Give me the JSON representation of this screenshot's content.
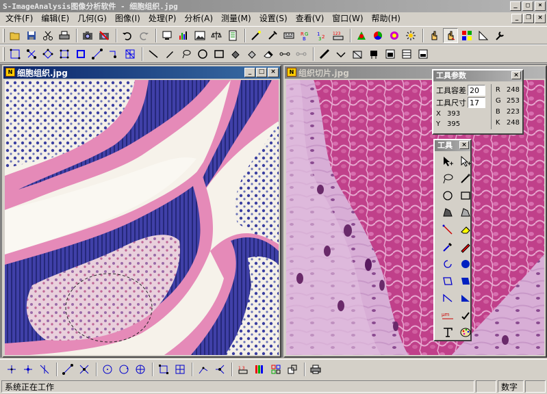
{
  "app": {
    "title": "S-ImageAnalysis图像分析软件 - 细胞组织.jpg"
  },
  "menu": [
    "文件(F)",
    "编辑(E)",
    "几何(G)",
    "图像(I)",
    "处理(P)",
    "分析(A)",
    "测量(M)",
    "设置(S)",
    "查看(V)",
    "窗口(W)",
    "帮助(H)"
  ],
  "windows": {
    "left": {
      "title": "细胞组织.jpg",
      "icon_text": "N"
    },
    "right": {
      "title": "组织切片.jpg",
      "icon_text": "N"
    }
  },
  "tool_params": {
    "title": "工具参数",
    "tolerance_label": "工具容差",
    "tolerance_value": "20",
    "size_label": "工具尺寸",
    "size_value": "17",
    "x_label": "X",
    "x_value": "393",
    "y_label": "Y",
    "y_value": "395",
    "r_label": "R",
    "r_value": "248",
    "g_label": "G",
    "g_value": "253",
    "b_label": "B",
    "b_value": "223",
    "k_label": "K",
    "k_value": "248"
  },
  "tools_palette": {
    "title": "工具"
  },
  "status": {
    "message": "系统正在工作",
    "mode": "数字"
  },
  "colors": {
    "tissue_pink": "#e58ab8",
    "nucleus_blue": "#3a3ea0",
    "active_title": "#0a246a",
    "hne_magenta": "#c0408a"
  }
}
